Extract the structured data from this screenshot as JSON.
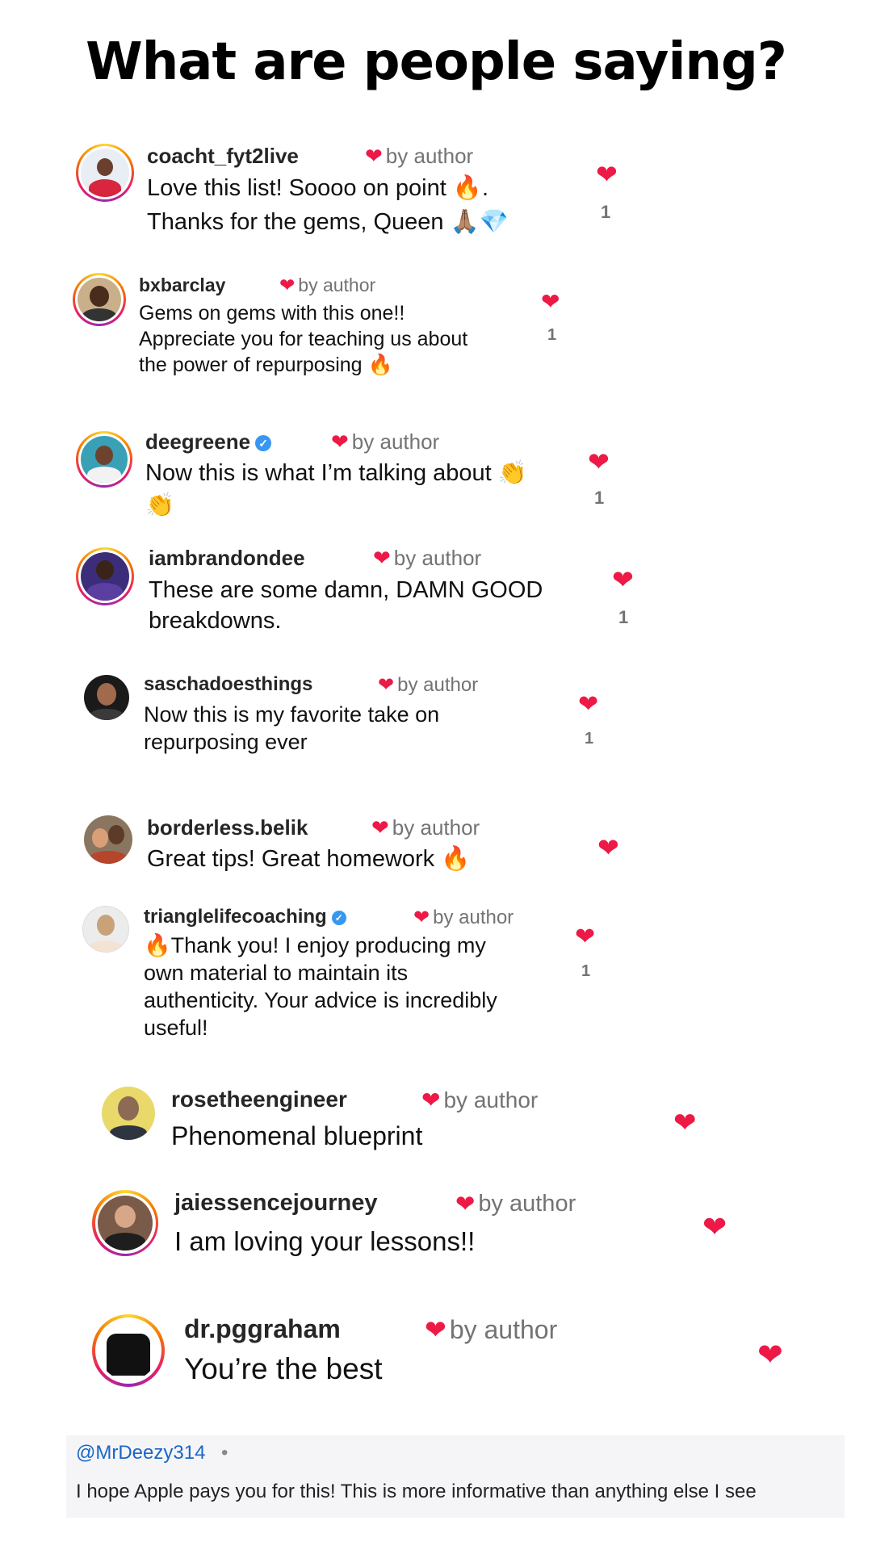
{
  "title": "What are people saying?",
  "by_author_label": "by author",
  "colors": {
    "heart": "#ed1946",
    "verified": "#3897f0",
    "link": "#1a66c7"
  },
  "comments": [
    {
      "username": "coacht_fyt2live",
      "verified": false,
      "lines": [
        "Love this list!  Soooo on point 🔥.",
        "Thanks for the gems, Queen 🙏🏽💎"
      ],
      "likes": "1"
    },
    {
      "username": "bxbarclay",
      "verified": false,
      "lines": [
        "Gems on gems with this one!!",
        "Appreciate you for teaching us about",
        "the power of repurposing 🔥"
      ],
      "likes": "1"
    },
    {
      "username": "deegreene",
      "verified": true,
      "lines": [
        "Now this is what I’m talking about 👏",
        "👏"
      ],
      "likes": "1"
    },
    {
      "username": "iambrandondee",
      "verified": false,
      "lines": [
        "These are some damn, DAMN GOOD",
        "breakdowns."
      ],
      "likes": "1"
    },
    {
      "username": "saschadoesthings",
      "verified": false,
      "lines": [
        "Now this is my favorite take on",
        "repurposing ever"
      ],
      "likes": "1"
    },
    {
      "username": "borderless.belik",
      "verified": false,
      "lines": [
        "Great tips! Great homework 🔥"
      ],
      "likes": ""
    },
    {
      "username": "trianglelifecoaching",
      "verified": true,
      "lines": [
        "🔥Thank you! I enjoy producing my",
        "own material to maintain its",
        "authenticity. Your advice is incredibly",
        "useful!"
      ],
      "likes": "1"
    },
    {
      "username": "rosetheengineer",
      "verified": false,
      "lines": [
        "Phenomenal blueprint"
      ],
      "likes": ""
    },
    {
      "username": "jaiessencejourney",
      "verified": false,
      "lines": [
        "I am loving your lessons!!"
      ],
      "likes": ""
    },
    {
      "username": "dr.pggraham",
      "verified": false,
      "lines": [
        "You’re the best"
      ],
      "likes": ""
    }
  ],
  "youtube_comment": {
    "handle": "@MrDeezy314",
    "separator": "•",
    "text": "I hope Apple pays you for this! This is more informative than anything else I see"
  }
}
